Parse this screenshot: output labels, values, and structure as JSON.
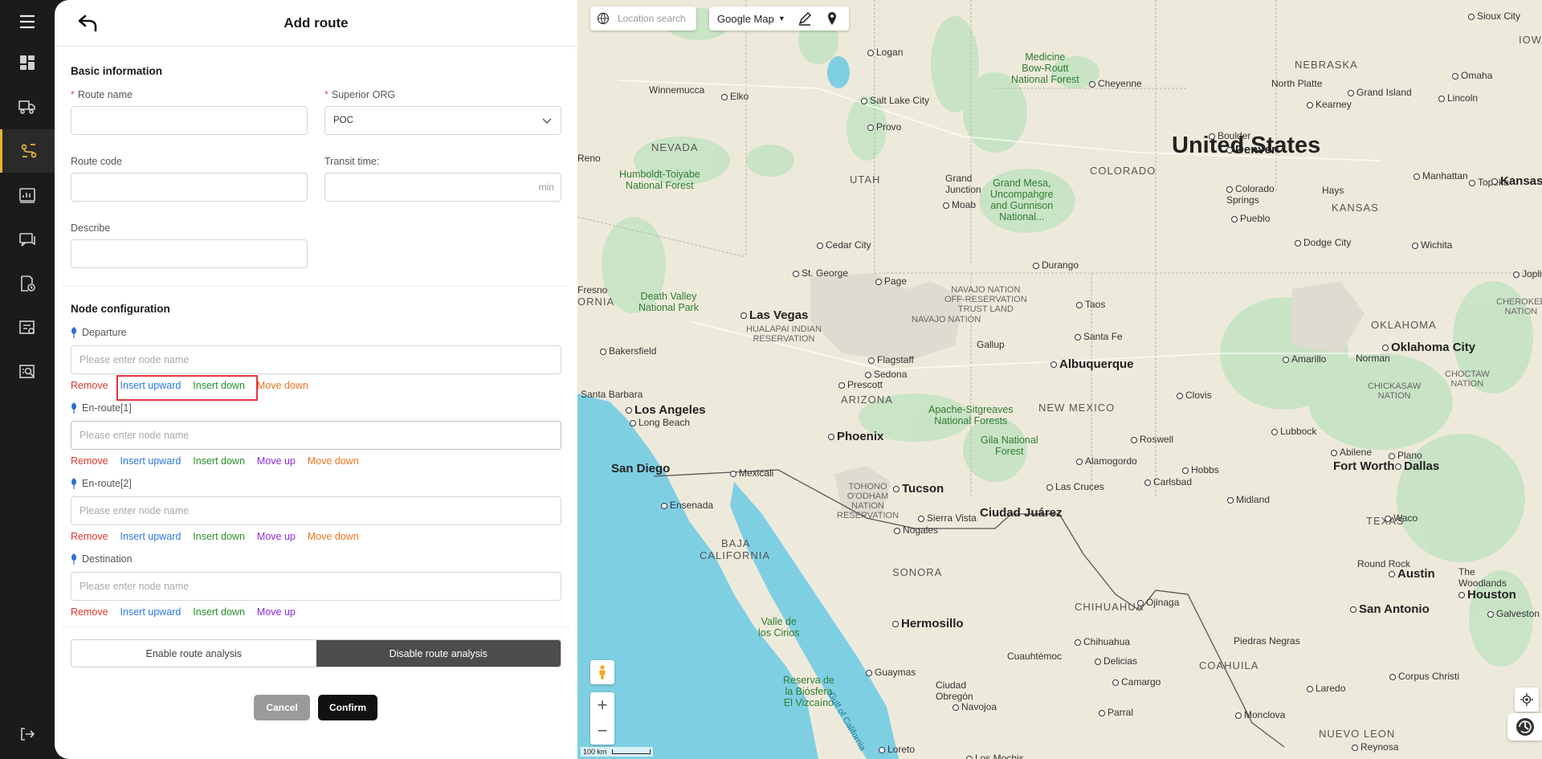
{
  "panel": {
    "title": "Add route",
    "basic_info_title": "Basic information",
    "route_name_label": "Route name",
    "superior_org_label": "Superior ORG",
    "superior_org_value": "POC",
    "route_code_label": "Route code",
    "transit_time_label": "Transit time:",
    "transit_time_unit": "min",
    "describe_label": "Describe",
    "required_mark": "*"
  },
  "nodes": {
    "title": "Node configuration",
    "placeholder": "Please enter node name",
    "items": [
      {
        "label": "Departure"
      },
      {
        "label": "En-route[1]"
      },
      {
        "label": "En-route[2]"
      },
      {
        "label": "Destination"
      }
    ],
    "actions": {
      "remove": "Remove",
      "insert_upward": "Insert upward",
      "insert_down": "Insert down",
      "move_up": "Move up",
      "move_down": "Move down"
    }
  },
  "route_analysis": {
    "enable_label": "Enable route analysis",
    "disable_label": "Disable route analysis",
    "selected": "disable"
  },
  "buttons": {
    "cancel": "Cancel",
    "confirm": "Confirm"
  },
  "map": {
    "search_placeholder": "Location search",
    "map_type": "Google Map",
    "scale": "100 km",
    "labels": {
      "country": "United States",
      "nevada": "NEVADA",
      "utah": "UTAH",
      "colorado": "COLORADO",
      "kansas": "KANSAS",
      "nebraska": "NEBRASKA",
      "arizona": "ARIZONA",
      "new_mexico": "NEW MEXICO",
      "oklahoma_state": "OKLAHOMA",
      "texas": "TEXAS",
      "sonora": "SONORA",
      "chihuahua_state": "CHIHUAHUA",
      "coahuila": "COAHUILA",
      "nuevo_leon": "NUEVO LEON",
      "baja": "BAJA",
      "california": "CALIFORNIA",
      "ornia": "ORNIA",
      "denver": "Denver",
      "las_vegas": "Las Vegas",
      "los_angeles": "Los Angeles",
      "phoenix": "Phoenix",
      "tucson": "Tucson",
      "albuquerque": "Albuquerque",
      "san_diego": "San Diego",
      "ciudad_juarez": "Ciudad Juárez",
      "hermosillo": "Hermosillo",
      "fort_worth": "Fort Worth",
      "dallas": "Dallas",
      "austin": "Austin",
      "san_antonio": "San Antonio",
      "houston": "Houston",
      "oklahoma_city": "Oklahoma City",
      "salt_lake": "Salt Lake City",
      "provo": "Provo",
      "logan": "Logan",
      "cheyenne": "Cheyenne",
      "boulder": "Boulder",
      "north_platte": "North Platte",
      "omaha": "Omaha",
      "lincoln": "Lincoln",
      "grand_island": "Grand Island",
      "kearney": "Kearney",
      "sioux_city": "Sioux City",
      "manhattan": "Manhattan",
      "topeka": "Topeka",
      "kansas_city": "Kansas C",
      "hays": "Hays",
      "wichita": "Wichita",
      "dodge_city": "Dodge City",
      "joplin": "Joplin",
      "colorado_springs": "Colorado\nSprings",
      "pueblo": "Pueblo",
      "grand_junction": "Grand\nJunction",
      "moab": "Moab",
      "durango": "Durango",
      "cedar_city": "Cedar City",
      "st_george": "St. George",
      "page": "Page",
      "flagstaff": "Flagstaff",
      "sedona": "Sedona",
      "prescott": "Prescott",
      "gallup": "Gallup",
      "santa_fe": "Santa Fe",
      "taos": "Taos",
      "amarillo": "Amarillo",
      "norman": "Norman",
      "lubbock": "Lubbock",
      "clovis": "Clovis",
      "roswell": "Roswell",
      "hobbs": "Hobbs",
      "carlsbad": "Carlsbad",
      "alamogordo": "Alamogordo",
      "las_cruces": "Las Cruces",
      "abilene": "Abilene",
      "midland": "Midland",
      "plano": "Plano",
      "waco": "Waco",
      "round_rock": "Round Rock",
      "the_woodlands": "The\nWoodlands",
      "galveston": "Galveston",
      "corpus_christi": "Corpus Christi",
      "laredo": "Laredo",
      "reynosa": "Reynosa",
      "monclova": "Monclova",
      "piedras_negras": "Piedras Negras",
      "ojinaga": "Ojinaga",
      "chihuahua_city": "Chihuahua",
      "delicias": "Delicias",
      "camargo": "Camargo",
      "parral": "Parral",
      "cuauhtemoc": "Cuauhtémoc",
      "guaymas": "Guaymas",
      "ciudad_obregon": "Ciudad\nObregón",
      "navojoa": "Navojoa",
      "loreto": "Loreto",
      "nogales": "Nogales",
      "sierra_vista": "Sierra Vista",
      "mexicali": "Mexicali",
      "ensenada": "Ensenada",
      "bakersfield": "Bakersfield",
      "santa_barbara": "Santa Barbara",
      "long_beach": "Long Beach",
      "reno": "Reno",
      "fresno": "Fresno",
      "elko": "Elko",
      "winnemucca": "Winnemucca",
      "los_mochis": "Los Mochis",
      "park_medicine_bow": "Medicine\nBow-Routt\nNational Forest",
      "park_humboldt": "Humboldt-Toiyabe\nNational Forest",
      "park_grand_mesa": "Grand Mesa,\nUncompahgre\nand Gunnison\nNational...",
      "park_death_valley": "Death Valley\nNational Park",
      "park_apache": "Apache-Sitgreaves\nNational Forests",
      "park_gila": "Gila National\nForest",
      "park_valle": "Valle de\nlos Cirios",
      "park_vizcaino": "Reserva de\nla Biósfera\nEl Vizcaíno",
      "navajo_off": "NAVAJO NATION\nOFF-RESERVATION\nTRUST LAND",
      "navajo": "NAVAJO NATION",
      "hualapai": "HUALAPAI INDIAN\nRESERVATION",
      "tohono": "TOHONO\nO'ODHAM\nNATION\nRESERVATION",
      "cherokee": "CHEROKEE\nNATION",
      "chickasaw": "CHICKASAW\nNATION",
      "choctaw": "CHOCTAW\nNATION",
      "gulf": "Gulf of California",
      "iowa": "IOWA"
    }
  }
}
